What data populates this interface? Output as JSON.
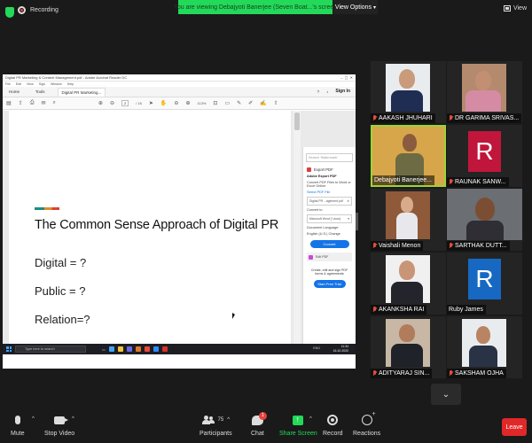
{
  "topbar": {
    "recording_label": "Recording",
    "viewing_banner": "You are viewing Debajyoti Banerjee (Seven Boat...'s screen",
    "view_options": "View Options",
    "view_label": "View"
  },
  "pdf": {
    "window_title": "Digital PR Marketing & Content Management.pdf - Adobe Acrobat Reader DC",
    "menu": [
      "File",
      "Edit",
      "View",
      "Sign",
      "Window",
      "Help"
    ],
    "tabs": [
      "Home",
      "Tools",
      "Digital PR Marketing..."
    ],
    "sign_in": "Sign In",
    "page_current": "2",
    "page_total": "/ 16",
    "zoom": "113%",
    "headline": "The Common Sense Approach of Digital PR",
    "lines": [
      "Digital = ?",
      "Public = ?",
      "Relation=?"
    ],
    "right_pane": {
      "search": "Search 'Watermark'",
      "export_title": "Export PDF",
      "export_header": "Adobe Export PDF",
      "export_desc": "Convert PDF Files to Word or Excel Online",
      "select_label": "Select PDF File",
      "file_name": "Digital PR ...agement.pdf",
      "convert_to": "Convert to",
      "format": "Microsoft Word (*.docx)",
      "doc_lang": "Document Language:",
      "lang_value": "English (U.S.) Change",
      "convert_btn": "Convert",
      "edit_pdf": "Edit PDF",
      "promo": "Create, edit and sign PDF forms & agreements",
      "trial_btn": "Start Free Trial"
    },
    "taskbar": {
      "search_placeholder": "Type here to search",
      "time": "11:34",
      "date": "16-10-2020",
      "lang": "ENG"
    }
  },
  "participants": [
    {
      "name": "AAKASH JHUHARI",
      "muted": true
    },
    {
      "name": "DR GARIMA SRIVAS...",
      "muted": true
    },
    {
      "name": "Debajyoti Banerjee...",
      "muted": false,
      "active": true
    },
    {
      "name": "RAUNAK SANW...",
      "muted": true,
      "letter": "R"
    },
    {
      "name": "Vaishali Menon",
      "muted": true
    },
    {
      "name": "SARTHAK DUTT...",
      "muted": true
    },
    {
      "name": "AKANKSHA RAI",
      "muted": true
    },
    {
      "name": "Ruby James",
      "muted": false,
      "letter": "R"
    },
    {
      "name": "ADITYARAJ SIN...",
      "muted": true
    },
    {
      "name": "SAKSHAM OJHA",
      "muted": true
    }
  ],
  "toolbar": {
    "mute": "Mute",
    "stop_video": "Stop Video",
    "participants_label": "Participants",
    "participants_count": "75",
    "chat": "Chat",
    "chat_badge": "1",
    "share_screen": "Share Screen",
    "record": "Record",
    "reactions": "Reactions",
    "leave": "Leave"
  },
  "colors": {
    "zoom_green": "#23d959",
    "leave_red": "#e02828",
    "avatar_red": "#c0163b",
    "avatar_blue": "#1768c2",
    "active_border": "#9bd43a"
  }
}
